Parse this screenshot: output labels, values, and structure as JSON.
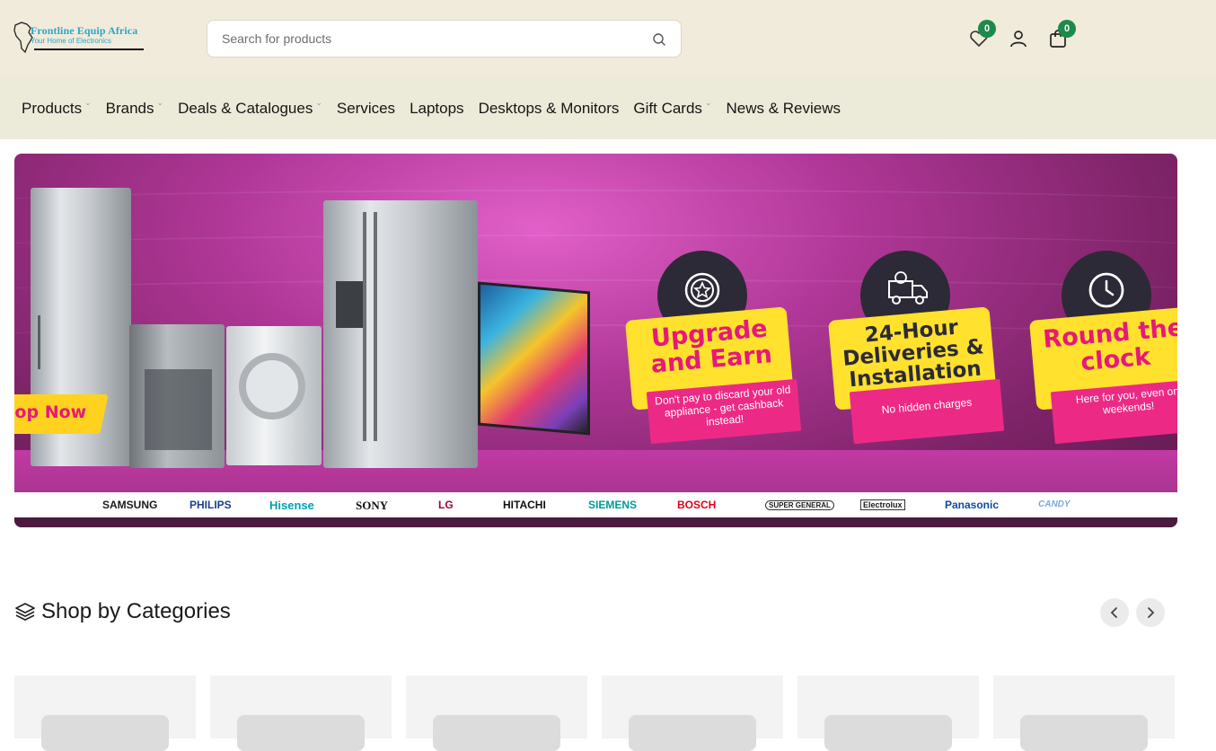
{
  "header": {
    "logo_name": "Frontline Equip Africa",
    "logo_tagline": "Your Home of Electronics",
    "search_placeholder": "Search for products",
    "wishlist_count": "0",
    "cart_count": "0"
  },
  "nav": {
    "items": [
      {
        "label": "Products",
        "has_dropdown": true
      },
      {
        "label": "Brands",
        "has_dropdown": true
      },
      {
        "label": "Deals & Catalogues",
        "has_dropdown": true
      },
      {
        "label": "Services",
        "has_dropdown": false
      },
      {
        "label": "Laptops",
        "has_dropdown": false
      },
      {
        "label": "Desktops & Monitors",
        "has_dropdown": false
      },
      {
        "label": "Gift Cards",
        "has_dropdown": true
      },
      {
        "label": "News & Reviews",
        "has_dropdown": false
      }
    ]
  },
  "hero": {
    "shop_now": "op Now",
    "promos": [
      {
        "headline": "Upgrade and Earn",
        "sub": "Don't pay to discard your old appliance - get cashback instead!",
        "icon": "star-badge-icon"
      },
      {
        "headline": "24-Hour Deliveries & Installation",
        "sub": "No hidden charges",
        "icon": "delivery-truck-icon"
      },
      {
        "headline": "Round the clock",
        "sub": "Here for you, even on weekends!",
        "icon": "clock-icon"
      }
    ],
    "brands": [
      "SAMSUNG",
      "PHILIPS",
      "Hisense",
      "SONY",
      "LG",
      "HITACHI",
      "SIEMENS",
      "BOSCH",
      "SUPER GENERAL",
      "Electrolux",
      "Panasonic",
      "CANDY"
    ],
    "colors": {
      "background": "#b03797",
      "accent_yellow": "#ffe12e",
      "accent_pink": "#e5197c"
    }
  },
  "categories": {
    "title": "Shop by Categories",
    "prev_icon": "chevron-left-icon",
    "next_icon": "chevron-right-icon",
    "cards": [
      "",
      "",
      "",
      "",
      "",
      ""
    ]
  }
}
